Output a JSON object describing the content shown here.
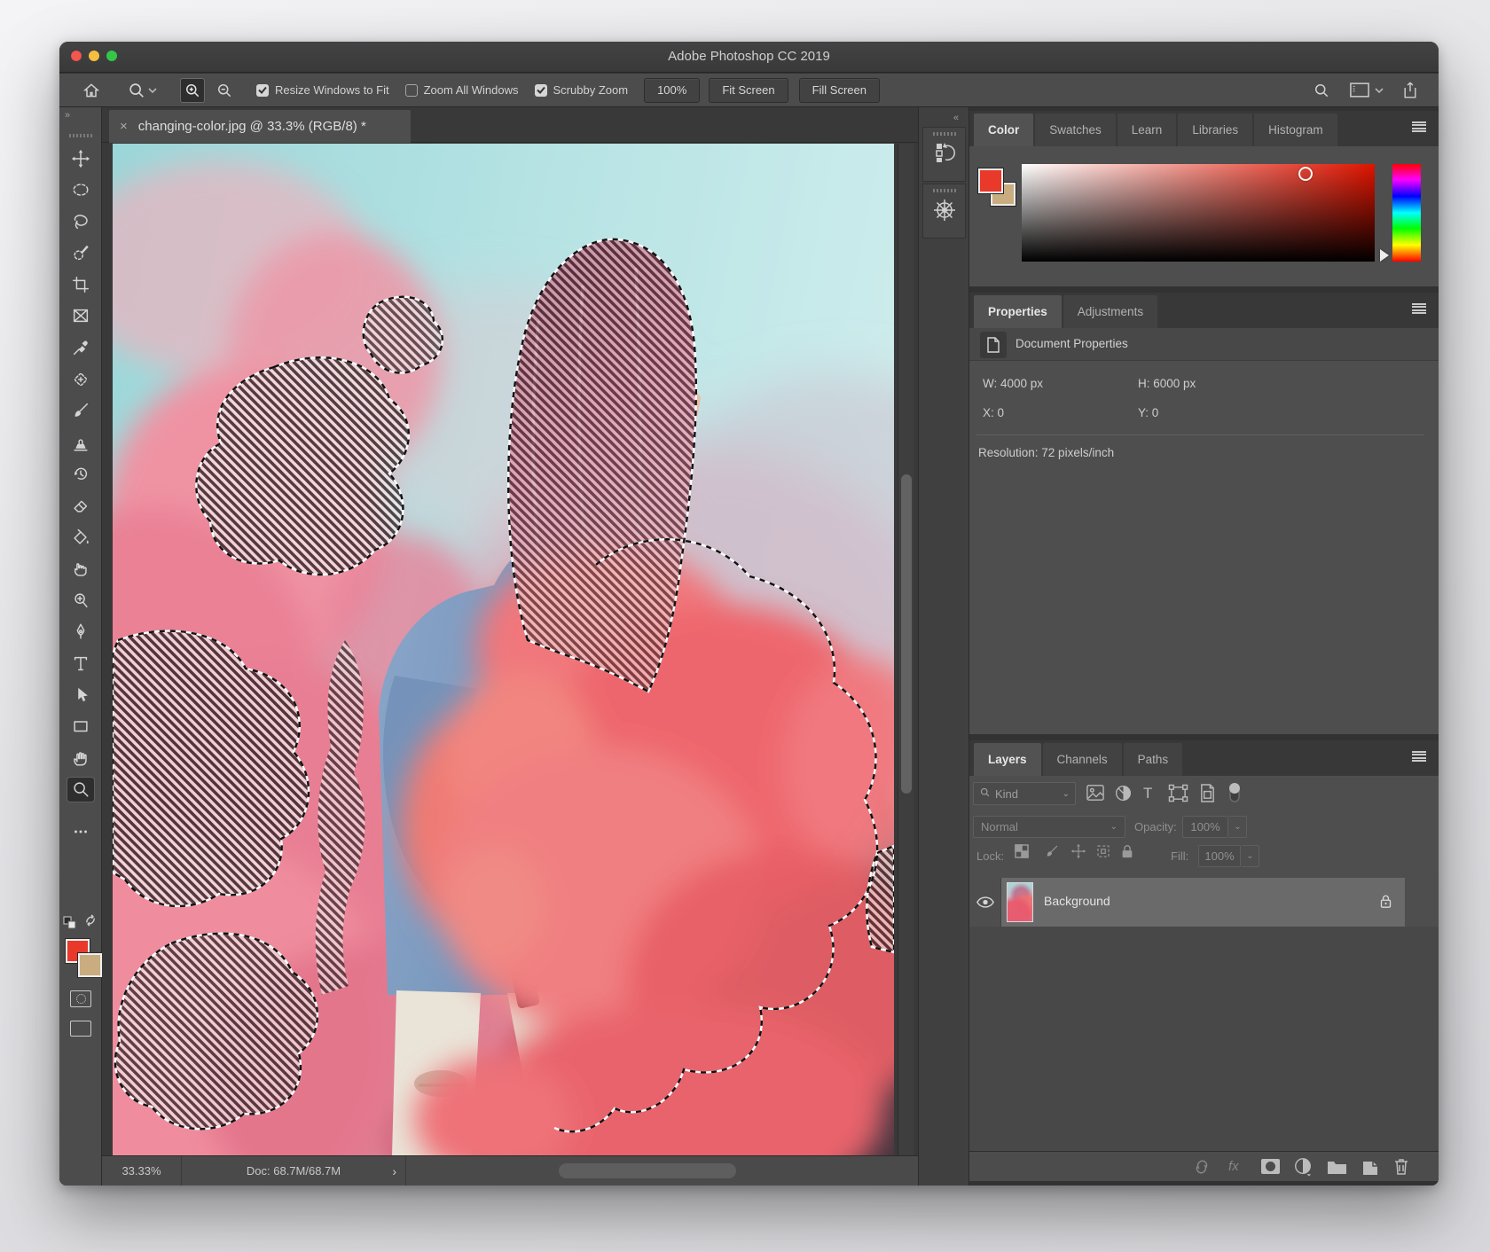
{
  "titlebar": {
    "title": "Adobe Photoshop CC 2019"
  },
  "options": {
    "resize_windows_label": "Resize Windows to Fit",
    "resize_windows_checked": true,
    "zoom_all_label": "Zoom All Windows",
    "zoom_all_checked": false,
    "scrubby_label": "Scrubby Zoom",
    "scrubby_checked": true,
    "zoom_percent": "100%",
    "fit_screen_label": "Fit Screen",
    "fill_screen_label": "Fill Screen"
  },
  "document_tab": {
    "title": "changing-color.jpg @ 33.3% (RGB/8) *",
    "close_glyph": "×"
  },
  "toolbar": {
    "collapse_glyph": "»",
    "tools": [
      "move",
      "elliptical-marquee",
      "lasso",
      "quick-selection",
      "crop",
      "frame",
      "eyedropper",
      "spot-healing-brush",
      "brush",
      "clone-stamp",
      "history-brush",
      "eraser",
      "paint-bucket",
      "smudge",
      "dodge",
      "pen",
      "type",
      "path-selection",
      "rectangle",
      "hand",
      "zoom",
      "more-options"
    ],
    "active_tool": "zoom",
    "foreground_color": "#e8392b",
    "background_color": "#c9ad80"
  },
  "dock": {
    "collapse_glyph": "«",
    "icons": [
      "history-panel",
      "navigator-panel"
    ]
  },
  "color_panel": {
    "tabs": [
      "Color",
      "Swatches",
      "Learn",
      "Libraries",
      "Histogram"
    ],
    "active_tab": "Color",
    "foreground_color": "#e8392b",
    "background_color": "#c9ad80"
  },
  "properties_panel": {
    "tabs": [
      "Properties",
      "Adjustments"
    ],
    "active_tab": "Properties",
    "header": "Document Properties",
    "w_label": "W:",
    "w_value": "4000 px",
    "h_label": "H:",
    "h_value": "6000 px",
    "x_label": "X:",
    "x_value": "0",
    "y_label": "Y:",
    "y_value": "0",
    "resolution": "Resolution: 72 pixels/inch"
  },
  "layers_panel": {
    "tabs": [
      "Layers",
      "Channels",
      "Paths"
    ],
    "active_tab": "Layers",
    "filter_label": "Kind",
    "blend_mode": "Normal",
    "opacity_label": "Opacity:",
    "opacity_value": "100%",
    "lock_label": "Lock:",
    "fill_label": "Fill:",
    "fill_value": "100%",
    "layer": {
      "name": "Background",
      "visible": true,
      "locked": true
    }
  },
  "status_bar": {
    "zoom_level": "33.33%",
    "doc_size": "Doc: 68.7M/68.7M",
    "expand_glyph": "›"
  }
}
